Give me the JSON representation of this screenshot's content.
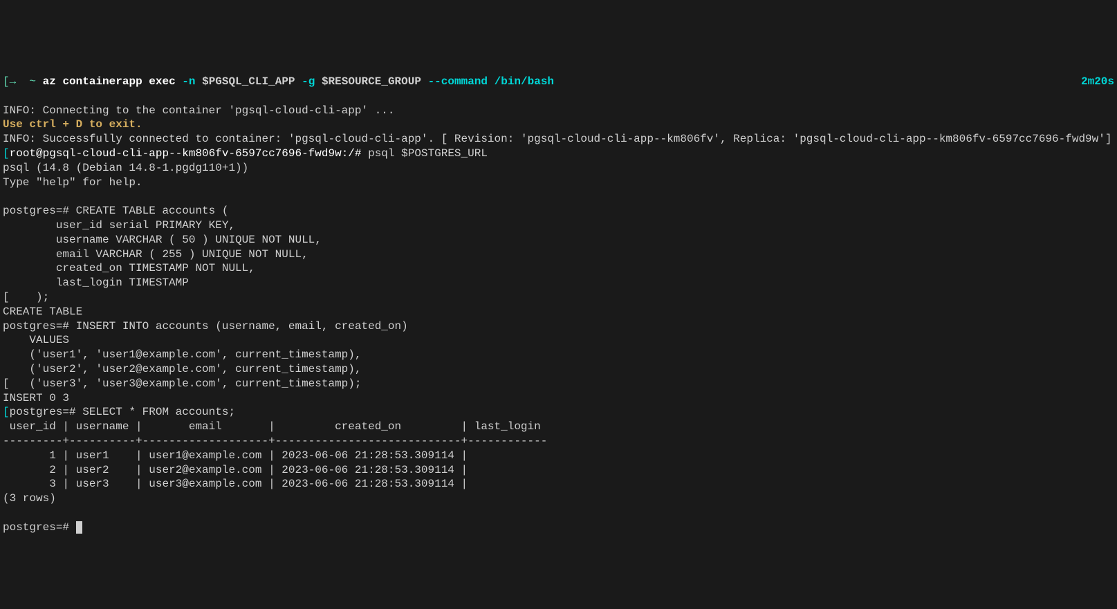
{
  "header": {
    "bracket_open": "[",
    "arrow": "→",
    "tilde": "~",
    "cmd": "az containerapp exec",
    "flag1": "-n",
    "var1": "$PGSQL_CLI_APP",
    "flag2": "-g",
    "var2": "$RESOURCE_GROUP",
    "flag3": "--command",
    "path": "/bin/bash",
    "elapsed": "2m20s"
  },
  "line1": "INFO: Connecting to the container 'pgsql-cloud-cli-app' ...",
  "line2": "Use ctrl + D to exit.",
  "line3": "INFO: Successfully connected to container: 'pgsql-cloud-cli-app'. [ Revision: 'pgsql-cloud-cli-app--km806fv', Replica: 'pgsql-cloud-cli-app--km806fv-6597cc7696-fwd9w']",
  "shell": {
    "bracket": "[",
    "prompt": "root@pgsql-cloud-cli-app--km806fv-6597cc7696-fwd9w:/#",
    "cmd": " psql $POSTGRES_URL"
  },
  "psql_version": "psql (14.8 (Debian 14.8-1.pgdg110+1))",
  "psql_help": "Type \"help\" for help.",
  "blank": "",
  "pg_prompt": "postgres=#",
  "create_table": {
    "l1": " CREATE TABLE accounts (",
    "l2": "        user_id serial PRIMARY KEY,",
    "l3": "        username VARCHAR ( 50 ) UNIQUE NOT NULL,",
    "l4": "        email VARCHAR ( 255 ) UNIQUE NOT NULL,",
    "l5": "        created_on TIMESTAMP NOT NULL,",
    "l6": "        last_login TIMESTAMP",
    "l7": "[    );",
    "result": "CREATE TABLE"
  },
  "insert": {
    "l1": " INSERT INTO accounts (username, email, created_on)",
    "l2": "    VALUES",
    "l3": "    ('user1', 'user1@example.com', current_timestamp),",
    "l4": "    ('user2', 'user2@example.com', current_timestamp),",
    "l5": "[   ('user3', 'user3@example.com', current_timestamp);",
    "result": "INSERT 0 3"
  },
  "select": {
    "cmd": " SELECT * FROM accounts;",
    "header": " user_id | username |       email       |         created_on         | last_login ",
    "sep": "---------+----------+-------------------+----------------------------+------------",
    "r1": "       1 | user1    | user1@example.com | 2023-06-06 21:28:53.309114 | ",
    "r2": "       2 | user2    | user2@example.com | 2023-06-06 21:28:53.309114 | ",
    "r3": "       3 | user3    | user3@example.com | 2023-06-06 21:28:53.309114 | ",
    "count": "(3 rows)"
  },
  "final_prompt": "postgres=# ",
  "bracket_left": "["
}
